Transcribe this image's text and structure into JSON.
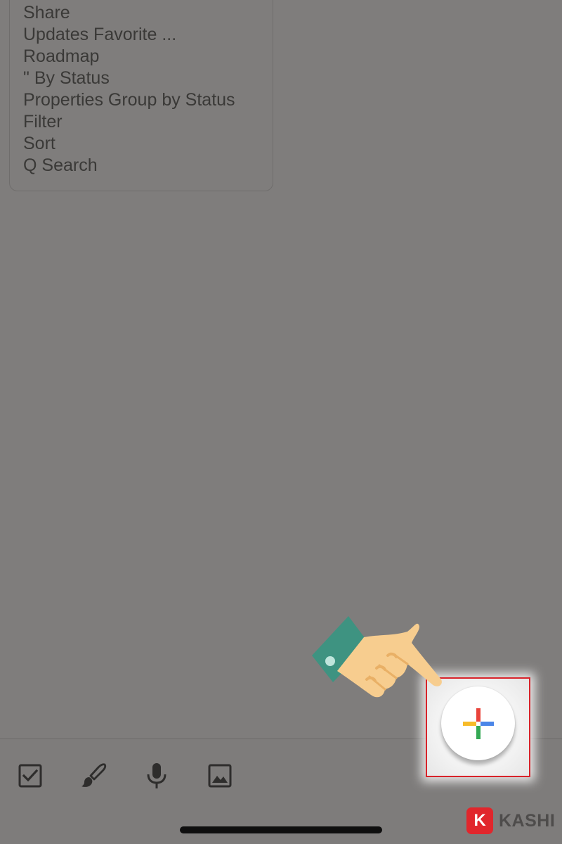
{
  "note": {
    "lines": [
      "Share",
      "Updates Favorite ...",
      "Roadmap",
      "\" By Status",
      "Properties Group by Status",
      "Filter",
      "Sort",
      "Q Search"
    ]
  },
  "toolbar": {
    "items": [
      {
        "name": "checkbox-icon"
      },
      {
        "name": "brush-icon"
      },
      {
        "name": "microphone-icon"
      },
      {
        "name": "image-icon"
      }
    ]
  },
  "fab": {
    "icon": "plus-icon",
    "colors": {
      "top": "#e9433a",
      "right": "#4b86e8",
      "bottom": "#33a853",
      "left": "#f7bb29"
    },
    "highlight_color": "#d8232a"
  },
  "watermark": {
    "badge": "K",
    "text": "KASHI",
    "badge_color": "#e1262c"
  }
}
